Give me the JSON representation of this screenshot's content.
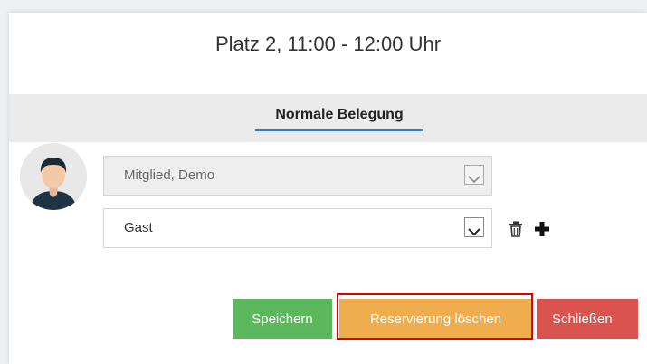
{
  "dialog": {
    "title": "Platz 2, 11:00 - 12:00 Uhr"
  },
  "tabs": [
    {
      "label": "Normale Belegung",
      "active": true
    }
  ],
  "players": {
    "member": {
      "value": "Mitglied, Demo",
      "disabled": true
    },
    "guest": {
      "value": "Gast",
      "disabled": false
    }
  },
  "buttons": {
    "save": "Speichern",
    "delete": "Reservierung löschen",
    "close": "Schließen"
  },
  "colors": {
    "accent": "#2f7ec9",
    "save": "#5cb85c",
    "delete": "#f0ad4e",
    "close": "#d9534f",
    "highlight": "#d90000"
  },
  "icons": {
    "avatar": "user-avatar-icon",
    "trash": "trash-icon",
    "plus": "plus-icon",
    "dropdown": "chevron-down-icon"
  }
}
